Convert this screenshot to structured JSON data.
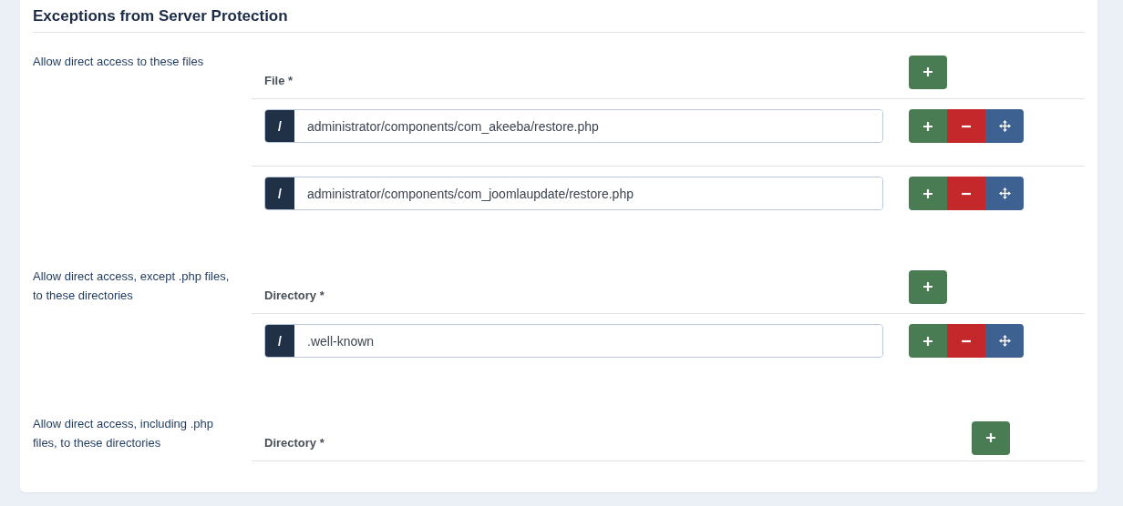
{
  "section_title": "Exceptions from Server Protection",
  "groups": [
    {
      "label": "Allow direct access to these files",
      "column": "File *",
      "rows": [
        {
          "prefix": "/",
          "value": "administrator/components/com_akeeba/restore.php"
        },
        {
          "prefix": "/",
          "value": "administrator/components/com_joomlaupdate/restore.php"
        }
      ]
    },
    {
      "label": "Allow direct access, except .php files, to these directories",
      "column": "Directory *",
      "rows": [
        {
          "prefix": "/",
          "value": ".well-known"
        }
      ]
    },
    {
      "label": "Allow direct access, including .php files, to these directories",
      "column": "Directory *"
    }
  ]
}
